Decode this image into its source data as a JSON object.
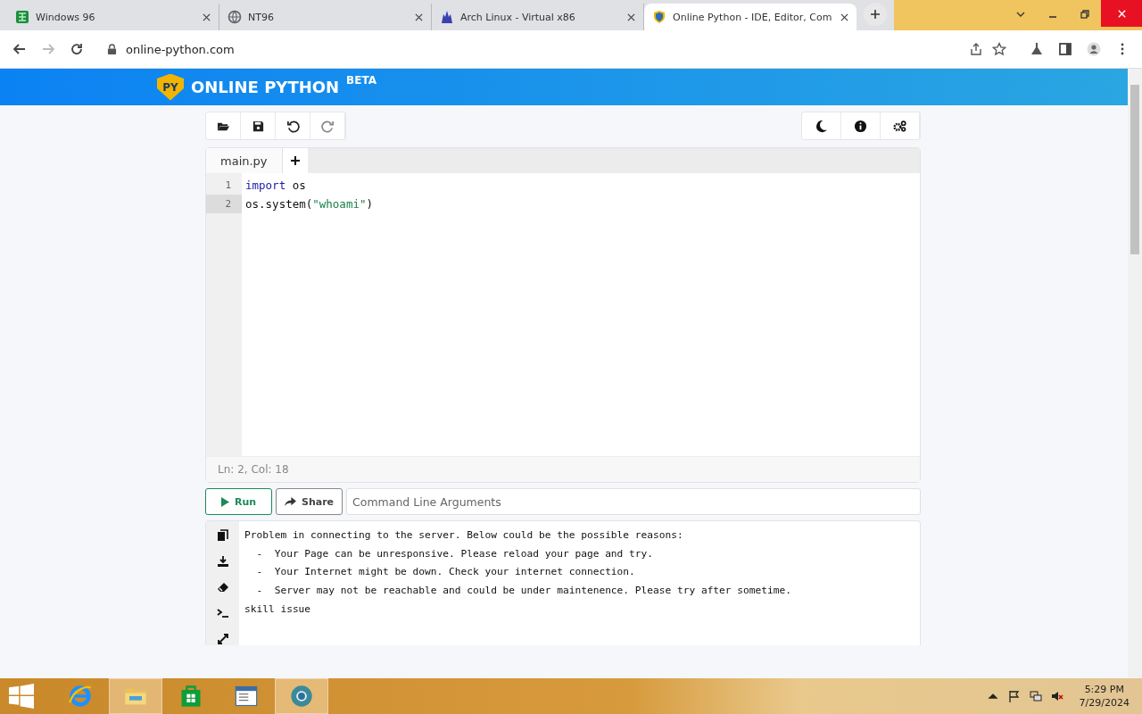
{
  "browser_tabs": [
    {
      "title": "Windows 96",
      "selected": false,
      "kind": "grid"
    },
    {
      "title": "NT96",
      "selected": false,
      "kind": "globe"
    },
    {
      "title": "Arch Linux - Virtual x86",
      "selected": false,
      "kind": "mascot"
    },
    {
      "title": "Online Python - IDE, Editor, Com",
      "selected": true,
      "kind": "shield"
    }
  ],
  "address_bar": {
    "url": "online-python.com"
  },
  "site_header": {
    "logo_badge": "PY",
    "title": "ONLINE PYTHON",
    "superscript": "BETA"
  },
  "editor": {
    "file_tabs": [
      {
        "label": "main.py",
        "selected": true
      }
    ],
    "lines": [
      {
        "number": "1",
        "active": false,
        "tokens": [
          {
            "text": "import",
            "kind": "keyword"
          },
          {
            "text": " os",
            "kind": "plain"
          }
        ]
      },
      {
        "number": "2",
        "active": true,
        "tokens": [
          {
            "text": "os.system(",
            "kind": "plain"
          },
          {
            "text": "\"whoami\"",
            "kind": "string"
          },
          {
            "text": ")",
            "kind": "plain"
          }
        ]
      }
    ],
    "status": "Ln: 2,  Col: 18"
  },
  "actions": {
    "run": "Run",
    "share": "Share",
    "arguments": {
      "placeholder": "Command Line Arguments"
    }
  },
  "output": {
    "lines": [
      "Problem in connecting to the server. Below could be the possible reasons:",
      "  -  Your Page can be unresponsive. Please reload your page and try.",
      "  -  Your Internet might be down. Check your internet connection.",
      "  -  Server may not be reachable and could be under maintenence. Please try after sometime.",
      "skill issue"
    ]
  },
  "taskbar": {
    "apps": [
      {
        "kind": "ie",
        "selected": false
      },
      {
        "kind": "folder",
        "selected": true
      },
      {
        "kind": "store",
        "selected": false
      },
      {
        "kind": "window",
        "selected": false
      },
      {
        "kind": "chrome",
        "selected": true
      }
    ],
    "time": "5:29 PM",
    "date": "7/29/2024"
  }
}
